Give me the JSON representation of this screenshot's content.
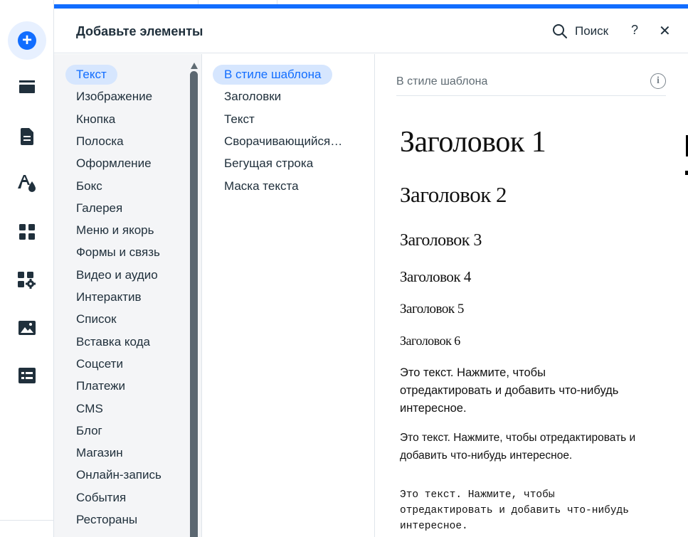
{
  "panel": {
    "title": "Добавьте элементы",
    "search_label": "Поиск",
    "help_label": "?",
    "close_label": "✕"
  },
  "rail": {
    "items": [
      "add-icon",
      "sections-icon",
      "pages-icon",
      "theme-icon",
      "apps-icon",
      "business-apps-icon",
      "media-icon",
      "cms-icon"
    ]
  },
  "categories": {
    "items": [
      {
        "label": "Текст",
        "active": true
      },
      {
        "label": "Изображение"
      },
      {
        "label": "Кнопка"
      },
      {
        "label": "Полоска"
      },
      {
        "label": "Оформление"
      },
      {
        "label": "Бокс"
      },
      {
        "label": "Галерея"
      },
      {
        "label": "Меню и якорь"
      },
      {
        "label": "Формы и связь"
      },
      {
        "label": "Видео и аудио"
      },
      {
        "label": "Интерактив"
      },
      {
        "label": "Список"
      },
      {
        "label": "Вставка кода"
      },
      {
        "label": "Соцсети"
      },
      {
        "label": "Платежи"
      },
      {
        "label": "CMS"
      },
      {
        "label": "Блог"
      },
      {
        "label": "Магазин"
      },
      {
        "label": "Онлайн-запись"
      },
      {
        "label": "События"
      },
      {
        "label": "Рестораны"
      }
    ]
  },
  "subcategories": {
    "items": [
      {
        "label": "В стиле шаблона",
        "active": true
      },
      {
        "label": "Заголовки"
      },
      {
        "label": "Текст"
      },
      {
        "label": "Сворачивающийся…"
      },
      {
        "label": "Бегущая строка"
      },
      {
        "label": "Маска текста"
      }
    ]
  },
  "preview": {
    "section_label": "В стиле шаблона",
    "info_icon": "i",
    "headings": [
      "Заголовок 1",
      "Заголовок 2",
      "Заголовок 3",
      "Заголовок 4",
      "Заголовок 5",
      "Заголовок 6"
    ],
    "paragraph_1": "Это текст. Нажмите, чтобы отредактировать и добавить что-нибудь интересное.",
    "paragraph_2": "Это текст. Нажмите, чтобы отредактировать и добавить что-нибудь интересное.",
    "paragraph_3": "Это текст. Нажмите, чтобы отредактировать и добавить что-нибудь интересное."
  },
  "colors": {
    "accent": "#116dff",
    "active_bg": "#d6e6fe",
    "text": "#20303c",
    "column_bg": "#f4f5f7"
  }
}
